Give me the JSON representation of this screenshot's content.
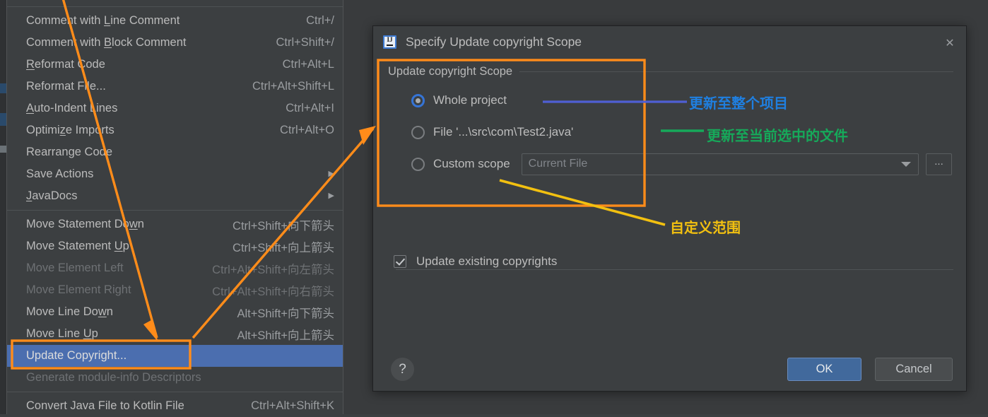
{
  "editor": {
    "sliver_fragments": 3
  },
  "context_menu": {
    "items": [
      {
        "label": "Comment with ",
        "label_underline": "L",
        "label_rest": "ine Comment",
        "key": "Ctrl+/",
        "state": "normal"
      },
      {
        "label": "Comment with ",
        "label_underline": "B",
        "label_rest": "lock Comment",
        "key": "Ctrl+Shift+/",
        "state": "normal"
      },
      {
        "label": "",
        "label_underline": "R",
        "label_rest": "eformat Code",
        "key": "Ctrl+Alt+L",
        "state": "normal"
      },
      {
        "label": "Reformat File...",
        "label_underline": "",
        "label_rest": "",
        "key": "Ctrl+Alt+Shift+L",
        "state": "normal"
      },
      {
        "label": "",
        "label_underline": "A",
        "label_rest": "uto-Indent Lines",
        "key": "Ctrl+Alt+I",
        "state": "normal"
      },
      {
        "label": "Optimi",
        "label_underline": "z",
        "label_rest": "e Imports",
        "key": "Ctrl+Alt+O",
        "state": "normal"
      },
      {
        "label": "Rearrange Code",
        "label_underline": "",
        "label_rest": "",
        "key": "",
        "state": "normal"
      },
      {
        "label": "Save Actions",
        "label_underline": "",
        "label_rest": "",
        "key": "",
        "state": "submenu"
      },
      {
        "label": "",
        "label_underline": "J",
        "label_rest": "avaDocs",
        "key": "",
        "state": "submenu"
      },
      {
        "label": "Move Statement Do",
        "label_underline": "w",
        "label_rest": "n",
        "key": "Ctrl+Shift+向下箭头",
        "state": "normal"
      },
      {
        "label": "Move Statement ",
        "label_underline": "U",
        "label_rest": "p",
        "key": "Ctrl+Shift+向上箭头",
        "state": "normal"
      },
      {
        "label": "Move Element Left",
        "label_underline": "",
        "label_rest": "",
        "key": "Ctrl+Alt+Shift+向左箭头",
        "state": "disabled"
      },
      {
        "label": "Move Element Right",
        "label_underline": "",
        "label_rest": "",
        "key": "Ctrl+Alt+Shift+向右箭头",
        "state": "disabled"
      },
      {
        "label": "Move Line Do",
        "label_underline": "w",
        "label_rest": "n",
        "key": "Alt+Shift+向下箭头",
        "state": "normal"
      },
      {
        "label": "Move Line ",
        "label_underline": "U",
        "label_rest": "p",
        "key": "Alt+Shift+向上箭头",
        "state": "normal"
      },
      {
        "label": "Update Copyright...",
        "label_underline": "",
        "label_rest": "",
        "key": "",
        "state": "selected"
      },
      {
        "label": "Generate module-info Descriptors",
        "label_underline": "",
        "label_rest": "",
        "key": "",
        "state": "disabled"
      },
      {
        "label": "Convert Java File to Kotlin File",
        "label_underline": "",
        "label_rest": "",
        "key": "Ctrl+Alt+Shift+K",
        "state": "normal"
      }
    ],
    "selected_item": "Update Copyright...",
    "selection_color": "#4b6eaf"
  },
  "dialog": {
    "icon": "intellij-idea-icon",
    "title": "Specify Update copyright Scope",
    "close_icon": "close-icon",
    "group": {
      "title": "Update copyright Scope",
      "options": [
        {
          "label": "Whole project",
          "selected": true
        },
        {
          "label": "File '...\\src\\com\\Test2.java'",
          "selected": false
        },
        {
          "label": "Custom scope",
          "selected": false
        }
      ],
      "combo": {
        "value": "Current File",
        "placeholder": "Current File",
        "arrow_icon": "chevron-down-icon",
        "disabled": true
      },
      "browse_button": "..."
    },
    "checkbox": {
      "label": "Update existing copyrights",
      "checked": true
    },
    "help_button": "?",
    "buttons": {
      "ok": "OK",
      "cancel": "Cancel"
    },
    "colors": {
      "ok_bg": "#41699c",
      "cancel_bg": "#4a4d4f"
    }
  },
  "annotations": {
    "highlight_boxes": [
      {
        "name": "update-copyright-menu-highlight",
        "color": "#ff8c1a"
      },
      {
        "name": "update-copyright-scope-group-highlight",
        "color": "#ff8c1a"
      }
    ],
    "labels": [
      {
        "text": "更新至整个项目",
        "color": "#1f7fe0",
        "leader": "#4f5fd4"
      },
      {
        "text": "更新至当前选中的文件",
        "color": "#16a95a",
        "leader": "#16a95a"
      },
      {
        "text": "自定义范围",
        "color": "#f2c010",
        "leader": "#f2c010"
      }
    ],
    "arrows": [
      {
        "name": "arrow-to-update-copyright",
        "color": "#ff8c1a"
      },
      {
        "name": "arrow-to-scope-dialog",
        "color": "#ff8c1a"
      }
    ]
  }
}
